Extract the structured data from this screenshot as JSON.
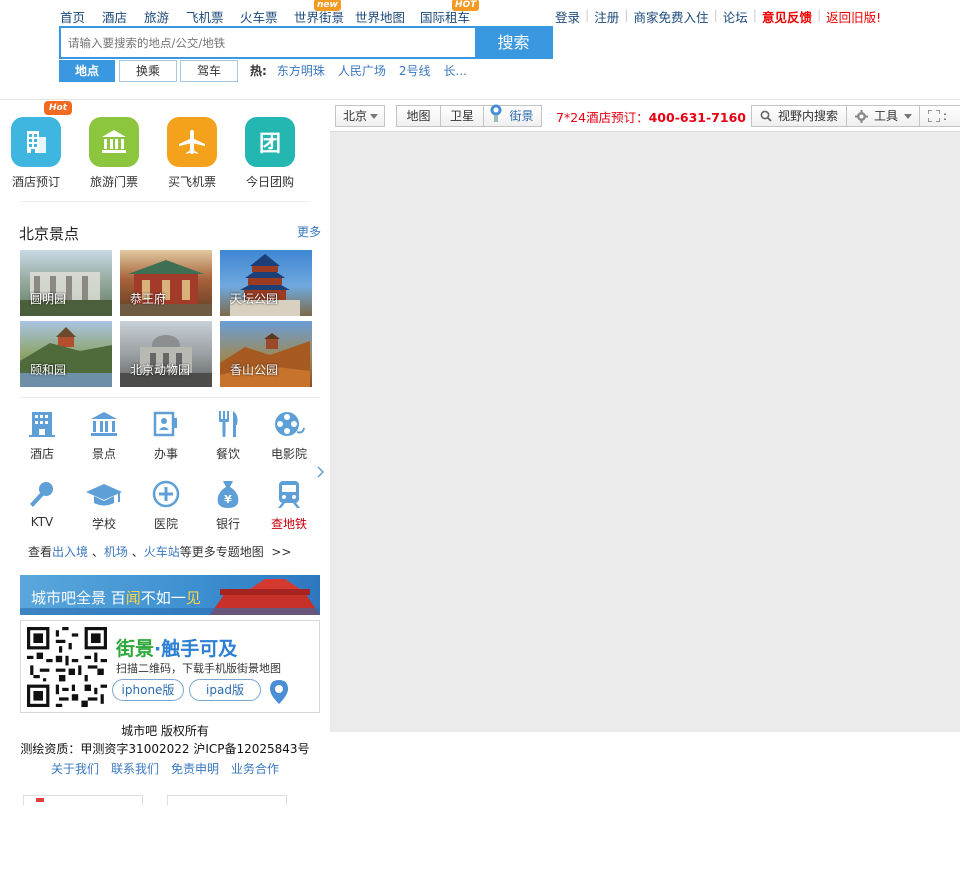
{
  "nav": {
    "items": [
      {
        "label": "首页"
      },
      {
        "label": "酒店"
      },
      {
        "label": "旅游"
      },
      {
        "label": "飞机票"
      },
      {
        "label": "火车票"
      },
      {
        "label": "世界街景",
        "badge": "new"
      },
      {
        "label": "世界地图"
      },
      {
        "label": "国际租车",
        "badge": "HOT"
      }
    ]
  },
  "user_links": {
    "login": "登录",
    "register": "注册",
    "merchant": "商家免费入住",
    "forum": "论坛",
    "feedback": "意见反馈",
    "old_version": "返回旧版!"
  },
  "search": {
    "placeholder": "请输入要搜索的地点/公交/地铁",
    "button": "搜索",
    "modes": [
      "地点",
      "换乘",
      "驾车"
    ],
    "active_mode": "地点",
    "hot_label": "热:",
    "hot_items": [
      "东方明珠",
      "人民广场",
      "2号线",
      "长..."
    ]
  },
  "services": [
    {
      "label": "酒店预订",
      "icon": "hotel-building-icon",
      "color": "#3fb6e0",
      "tag": "Hot"
    },
    {
      "label": "旅游门票",
      "icon": "museum-icon",
      "color": "#8cc63f"
    },
    {
      "label": "买飞机票",
      "icon": "airplane-icon",
      "color": "#f4a21b"
    },
    {
      "label": "今日团购",
      "icon": "group-buy-icon",
      "color": "#24b6b0",
      "glyph": "团"
    }
  ],
  "spots": {
    "title": "北京景点",
    "more": "更多",
    "items": [
      "圆明园",
      "恭王府",
      "天坛公园",
      "颐和园",
      "北京动物园",
      "香山公园"
    ]
  },
  "categories": [
    {
      "label": "酒店",
      "icon": "hotel-icon"
    },
    {
      "label": "景点",
      "icon": "landmark-icon"
    },
    {
      "label": "办事",
      "icon": "office-icon"
    },
    {
      "label": "餐饮",
      "icon": "fork-knife-icon"
    },
    {
      "label": "电影院",
      "icon": "film-reel-icon"
    },
    {
      "label": "KTV",
      "icon": "microphone-icon"
    },
    {
      "label": "学校",
      "icon": "graduation-cap-icon"
    },
    {
      "label": "医院",
      "icon": "hospital-cross-icon"
    },
    {
      "label": "银行",
      "icon": "money-bag-icon"
    },
    {
      "label": "查地铁",
      "icon": "subway-train-icon",
      "highlight": "#c8000a"
    }
  ],
  "more_line": {
    "prefix": "查看",
    "links": [
      "出入境",
      "机场",
      "火车站"
    ],
    "suffix": "等更多专题地图",
    "arrow": ">>"
  },
  "banner1": {
    "text_a": "城市吧全景 百",
    "text_b": "闻",
    "text_c": "不如一",
    "text_d": "见"
  },
  "banner2": {
    "title_a": "街景",
    "title_b": "·触手可及",
    "subtitle": "扫描二维码，下载手机版街景地图",
    "iphone": "iphone版",
    "ipad": "ipad版"
  },
  "footer": {
    "copyright": "城市吧  版权所有",
    "license": "测绘资质：甲测资字31002022 沪ICP备12025843号",
    "links": [
      "关于我们",
      "联系我们",
      "免责申明",
      "业务合作"
    ]
  },
  "map_toolbar": {
    "city": "北京",
    "map": "地图",
    "satellite": "卫星",
    "streetview": "街景",
    "hotline_prefix": "7*24酒店预订：",
    "hotline_number": "400-631-7160",
    "search_view": "视野内搜索",
    "tools": "工具",
    "fullscreen": ":"
  }
}
